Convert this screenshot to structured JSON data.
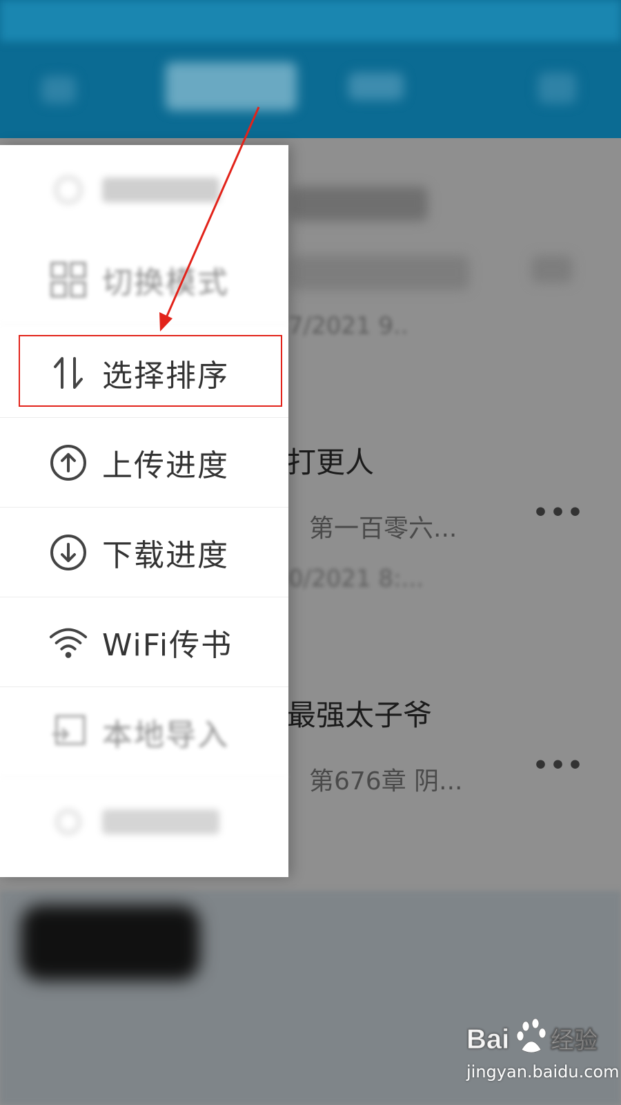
{
  "menu": {
    "items": [
      {
        "label": "切换模式",
        "icon": "grid-icon",
        "state": "partially-visible"
      },
      {
        "label": "选择排序",
        "icon": "sort-icon",
        "state": "highlighted"
      },
      {
        "label": "上传进度",
        "icon": "upload-circle-icon"
      },
      {
        "label": "下载进度",
        "icon": "download-circle-icon"
      },
      {
        "label": "WiFi传书",
        "icon": "wifi-icon"
      },
      {
        "label": "本地导入",
        "icon": "import-icon",
        "state": "partially-visible"
      }
    ]
  },
  "background": {
    "books": [
      {
        "title": "打更人",
        "chapter": "第一百零六...",
        "date": "0/2021 8:..."
      },
      {
        "title": "最强太子爷",
        "chapter": "第676章 阴..."
      }
    ],
    "partial_date": "7/2021 9..",
    "more_label": "•••"
  },
  "annotation": {
    "color": "#e2231a",
    "target": "选择排序"
  },
  "watermark": {
    "brand": "Bai 经验",
    "site": "jingyan.baidu.com"
  },
  "colors": {
    "topbar": "#0b6b93",
    "menu_bg": "#ffffff",
    "overlay": "#8f8f8f",
    "text": "#333333"
  }
}
